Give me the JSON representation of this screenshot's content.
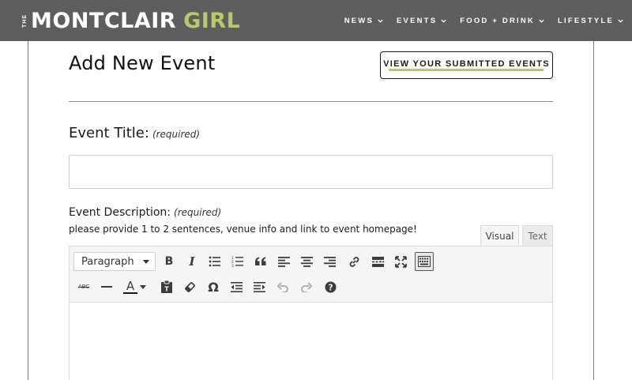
{
  "header": {
    "logo_the": "THE",
    "logo_main": "MONTCLAIR",
    "logo_accent": "GIRL",
    "accent_color": "#b7c96a",
    "bar_color": "#5d5e60",
    "nav": [
      {
        "label": "NEWS",
        "icon": "chevron-down-icon"
      },
      {
        "label": "EVENTS",
        "icon": "chevron-down-icon"
      },
      {
        "label": "FOOD + DRINK",
        "icon": "chevron-down-icon"
      },
      {
        "label": "LIFESTYLE",
        "icon": "chevron-down-icon"
      }
    ]
  },
  "page": {
    "title": "Add New Event",
    "view_submitted_label": "VIEW YOUR SUBMITTED EVENTS"
  },
  "form": {
    "event_title": {
      "label": "Event Title:",
      "required_note": "(required)",
      "value": "",
      "placeholder": ""
    },
    "event_description": {
      "label": "Event Description:",
      "required_note": "(required)",
      "hint": "please provide 1 to 2 sentences, venue info and link to event homepage!",
      "value": ""
    }
  },
  "editor": {
    "tabs": [
      {
        "label": "Visual",
        "active": true
      },
      {
        "label": "Text",
        "active": false
      }
    ],
    "format_select": {
      "selected": "Paragraph"
    },
    "toolbar_row1": [
      "bold-icon",
      "italic-icon",
      "bulleted-list-icon",
      "numbered-list-icon",
      "blockquote-icon",
      "align-left-icon",
      "align-center-icon",
      "align-right-icon",
      "link-icon",
      "read-more-icon",
      "fullscreen-icon",
      "toolbar-toggle-icon"
    ],
    "toolbar_row2": [
      "strikethrough-icon",
      "horizontal-line-icon",
      "text-color-icon",
      "paste-text-icon",
      "clear-formatting-icon",
      "special-character-icon",
      "outdent-icon",
      "indent-icon",
      "undo-icon",
      "redo-icon",
      "help-icon"
    ],
    "strike_label": "ABC",
    "text_color_letter": "A",
    "omega_glyph": "Ω",
    "bold_glyph": "B",
    "italic_glyph": "I"
  }
}
